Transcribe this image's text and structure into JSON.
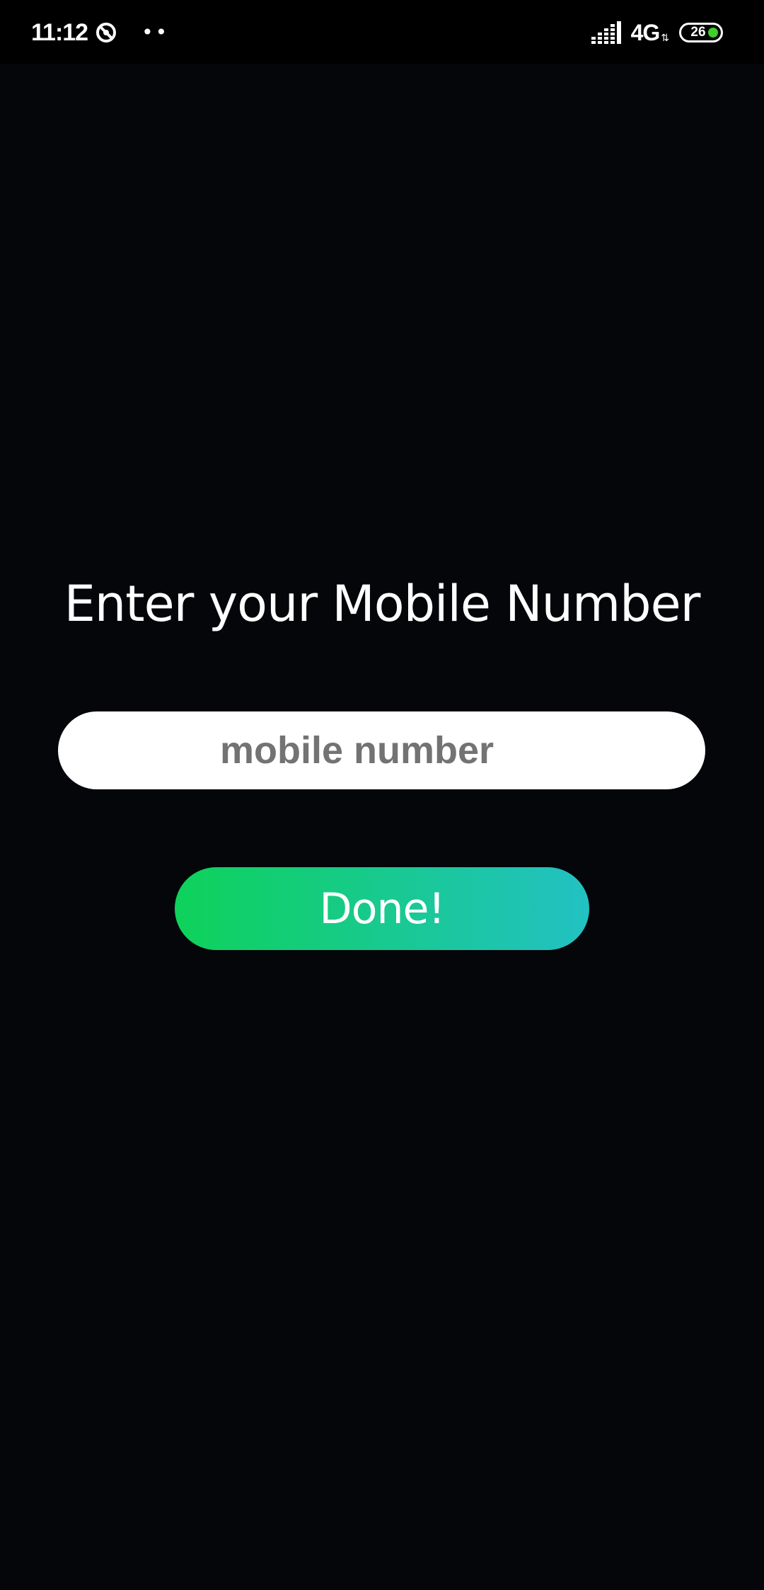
{
  "status_bar": {
    "time": "11:12",
    "dnd_icon": "do-not-disturb-icon",
    "dots": "••",
    "signal_icon": "cell-signal-icon",
    "network": "4G",
    "battery_level": "26",
    "battery_color": "#3ecf2a"
  },
  "screen": {
    "title": "Enter your Mobile Number",
    "mobile_input": {
      "placeholder": "mobile number",
      "value": ""
    },
    "done_button": {
      "label": "Done!",
      "gradient_start": "#0ed25a",
      "gradient_end": "#22c1c3"
    }
  }
}
